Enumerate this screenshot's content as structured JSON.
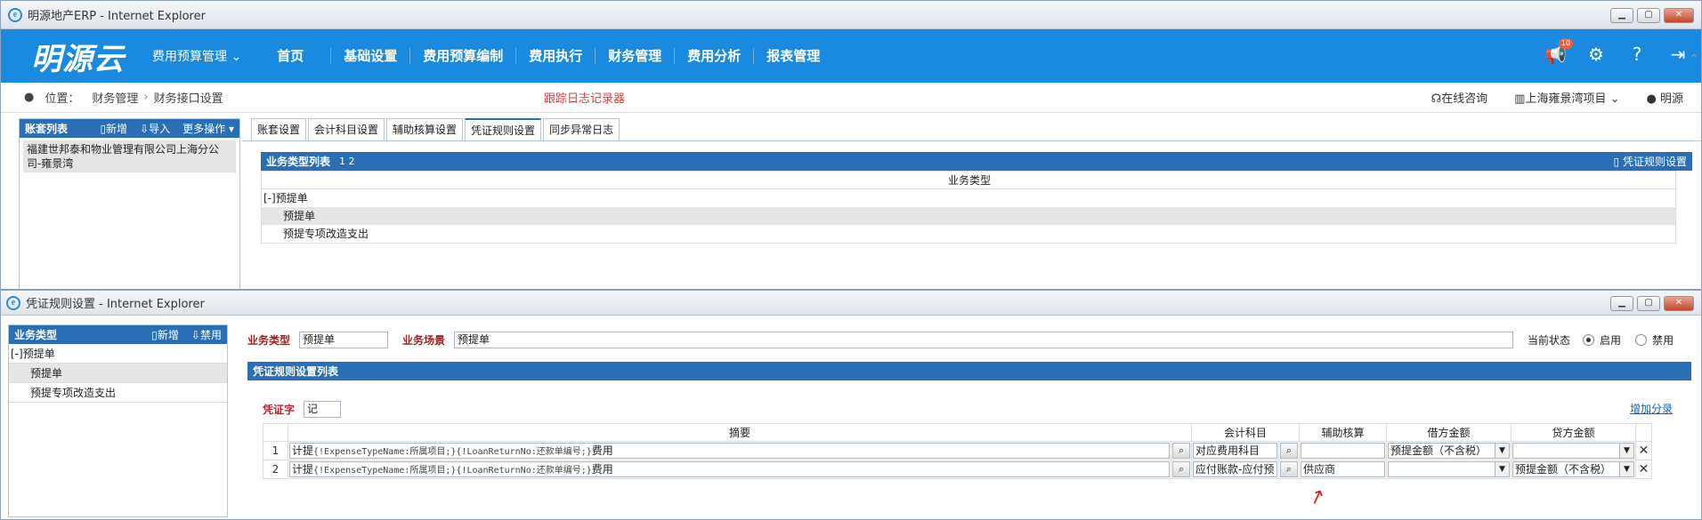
{
  "window1": {
    "title": "明源地产ERP - Internet Explorer",
    "logo": "明源云",
    "nav_dropdown": "费用预算管理",
    "nav_items": [
      "首页",
      "基础设置",
      "费用预算编制",
      "费用执行",
      "财务管理",
      "费用分析",
      "报表管理"
    ],
    "notif_count": "10",
    "breadcrumb": {
      "label": "位置：",
      "items": [
        "财务管理",
        "财务接口设置"
      ],
      "log_link": "跟踪日志记录器",
      "online": "在线咨询",
      "project": "上海雍景湾项目",
      "user": "明源"
    },
    "left_panel": {
      "title": "账套列表",
      "actions": [
        "新增",
        "导入",
        "更多操作"
      ],
      "company": "福建世邦泰和物业管理有限公司上海分公司-雍景湾"
    },
    "tabs": [
      "账套设置",
      "会计科目设置",
      "辅助核算设置",
      "凭证规则设置",
      "同步异常日志"
    ],
    "active_tab": 3,
    "list": {
      "title": "业务类型列表",
      "pages": "1 2",
      "right_button": "凭证规则设置",
      "column": "业务类型",
      "rows": [
        "[-]预提单",
        "预提单",
        "预提专项改造支出"
      ]
    }
  },
  "window2": {
    "title": "凭证规则设置 - Internet Explorer",
    "left_panel": {
      "title": "业务类型",
      "actions": [
        "新增",
        "禁用"
      ],
      "rows": [
        "[-]预提单",
        "预提单",
        "预提专项改造支出"
      ]
    },
    "form": {
      "type_label": "业务类型",
      "type_value": "预提单",
      "scene_label": "业务场景",
      "scene_value": "预提单",
      "status_label": "当前状态",
      "enabled": "启用",
      "disabled": "禁用"
    },
    "rules": {
      "title": "凭证规则设置列表",
      "voucher_label": "凭证字",
      "voucher_value": "记",
      "add_link": "增加分录",
      "columns": [
        "摘要",
        "会计科目",
        "辅助核算",
        "借方金额",
        "贷方金额"
      ],
      "rows": [
        {
          "no": "1",
          "summary_pre": "计提",
          "summary_code": "{!ExpenseTypeName:所属项目;}{!LoanReturnNo:还款单编号;}",
          "summary_post": "费用",
          "account": "对应费用科目",
          "aux": "",
          "debit": "预提金额（不含税）",
          "credit": ""
        },
        {
          "no": "2",
          "summary_pre": "计提",
          "summary_code": "{!ExpenseTypeName:所属项目;}{!LoanReturnNo:还款单编号;}",
          "summary_post": "费用",
          "account": "应付账款-应付预",
          "aux": "供应商",
          "debit": "",
          "credit": "预提金额（不含税）"
        }
      ]
    }
  },
  "colors": {
    "nav_blue": "#1a8ae0",
    "panel_blue": "#2a6fb5",
    "red_label": "#a02020",
    "annotation_red": "#e0201b"
  }
}
